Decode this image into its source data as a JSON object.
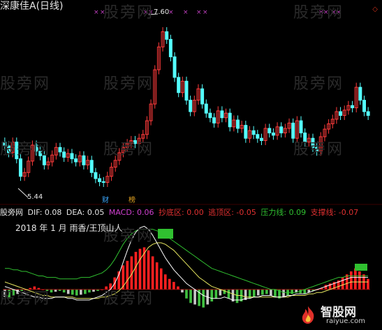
{
  "title": "深康佳A(日线)",
  "watermark": "股旁网",
  "price_high_label": "7.60",
  "price_low_label": "5.44",
  "event_markers": [
    {
      "label": "财",
      "color": "#3da9ff"
    },
    {
      "label": "榜",
      "color": "#e0a020"
    }
  ],
  "indicator": {
    "source": "股旁网",
    "items": [
      {
        "label": "DIF: 0.08",
        "color": "#e6e6e6"
      },
      {
        "label": "DEA: 0.05",
        "color": "#e6e6e6"
      },
      {
        "label": "MACD: 0.06",
        "color": "#d040d0"
      },
      {
        "label": "抄底区: 0.00",
        "color": "#e03030"
      },
      {
        "label": "逃顶区: -0.05",
        "color": "#e03030"
      },
      {
        "label": "压力线: 0.09",
        "color": "#30c030"
      },
      {
        "label": "支撑线: -0.07",
        "color": "#e03030"
      }
    ]
  },
  "period_note": "2018 年 1 月",
  "overlay_caption": "雨香/王顶山人",
  "logo": {
    "name": "智股网",
    "url": "raiyue.com"
  },
  "colors": {
    "up": "#ff3b3b",
    "down": "#54ffff",
    "macd_up": "#ff2020",
    "macd_down": "#40c040",
    "dif": "#ffffff",
    "dea": "#e8e860"
  },
  "chart_data": [
    {
      "type": "candlestick",
      "title": "深康佳A(日线)",
      "high": 7.6,
      "low": 5.44,
      "closes": [
        5.95,
        5.86,
        6.0,
        5.78,
        5.55,
        5.6,
        5.75,
        5.96,
        5.88,
        5.82,
        5.7,
        5.74,
        5.83,
        5.93,
        5.87,
        5.8,
        5.85,
        5.78,
        5.74,
        5.82,
        5.7,
        5.76,
        5.6,
        5.52,
        5.48,
        5.47,
        5.55,
        5.67,
        5.76,
        5.86,
        5.93,
        5.98,
        6.02,
        5.98,
        6.05,
        6.1,
        6.28,
        6.5,
        6.95,
        7.25,
        7.45,
        7.35,
        7.12,
        6.85,
        6.65,
        6.8,
        6.55,
        6.4,
        6.55,
        6.7,
        6.5,
        6.38,
        6.32,
        6.25,
        6.41,
        6.32,
        6.38,
        6.2,
        6.29,
        6.18,
        6.22,
        6.05,
        6.15,
        6.1,
        6.05,
        6.02,
        6.18,
        6.12,
        6.09,
        6.2,
        6.12,
        6.18,
        6.25,
        6.05,
        6.28,
        6.12,
        6.0,
        6.05,
        5.93,
        5.88,
        6.07,
        6.17,
        6.24,
        6.3,
        6.4,
        6.35,
        6.42,
        6.48,
        6.45,
        6.72,
        6.55,
        6.4,
        6.35
      ],
      "y_range": [
        5.3,
        7.72
      ],
      "legend": "none"
    },
    {
      "type": "bar",
      "title": "MACD",
      "series": [
        {
          "name": "MACD",
          "values": [
            -0.05,
            -0.06,
            -0.04,
            -0.03,
            -0.01,
            0.0,
            0.01,
            0.02,
            0.01,
            0.0,
            -0.01,
            -0.02,
            -0.015,
            -0.01,
            -0.02,
            -0.03,
            -0.035,
            -0.04,
            -0.035,
            -0.03,
            -0.02,
            -0.015,
            -0.01,
            0.0,
            0.02,
            0.04,
            0.08,
            0.12,
            0.16,
            0.19,
            0.22,
            0.25,
            0.27,
            0.28,
            0.26,
            0.22,
            0.18,
            0.14,
            0.1,
            0.07,
            0.05,
            0.02,
            -0.02,
            -0.06,
            -0.09,
            -0.1,
            -0.11,
            -0.12,
            -0.1,
            -0.08,
            -0.06,
            -0.04,
            -0.03,
            -0.06,
            -0.08,
            -0.09,
            -0.08,
            -0.07,
            -0.06,
            -0.05,
            -0.04,
            -0.035,
            -0.03,
            -0.04,
            -0.05,
            -0.06,
            -0.05,
            -0.04,
            -0.03,
            -0.02,
            -0.025,
            -0.03,
            -0.02,
            -0.01,
            0.0,
            0.01,
            0.03,
            0.04,
            0.05,
            0.06,
            0.08,
            0.1,
            0.12,
            0.14,
            0.12,
            0.1,
            0.07
          ]
        },
        {
          "name": "DIF",
          "values": [
            0.02,
            0.01,
            0.0,
            -0.01,
            -0.02,
            -0.03,
            -0.04,
            -0.05,
            -0.05,
            -0.06,
            -0.06,
            -0.06,
            -0.05,
            -0.05,
            -0.05,
            -0.06,
            -0.06,
            -0.07,
            -0.07,
            -0.07,
            -0.07,
            -0.06,
            -0.05,
            -0.04,
            -0.02,
            0.0,
            0.04,
            0.1,
            0.18,
            0.26,
            0.33,
            0.38,
            0.41,
            0.42,
            0.4,
            0.36,
            0.31,
            0.26,
            0.21,
            0.17,
            0.13,
            0.1,
            0.07,
            0.04,
            0.02,
            0.0,
            -0.02,
            -0.04,
            -0.05,
            -0.06,
            -0.06,
            -0.06,
            -0.05,
            -0.06,
            -0.07,
            -0.07,
            -0.07,
            -0.06,
            -0.06,
            -0.05,
            -0.05,
            -0.04,
            -0.04,
            -0.04,
            -0.05,
            -0.05,
            -0.05,
            -0.04,
            -0.04,
            -0.03,
            -0.03,
            -0.03,
            -0.02,
            -0.01,
            0.0,
            0.01,
            0.02,
            0.03,
            0.04,
            0.05,
            0.06,
            0.07,
            0.08,
            0.08,
            0.08,
            0.08,
            0.08
          ]
        },
        {
          "name": "DEA",
          "values": [
            0.05,
            0.04,
            0.03,
            0.02,
            0.01,
            0.0,
            -0.01,
            -0.02,
            -0.03,
            -0.04,
            -0.04,
            -0.05,
            -0.05,
            -0.05,
            -0.05,
            -0.05,
            -0.05,
            -0.06,
            -0.06,
            -0.06,
            -0.06,
            -0.06,
            -0.06,
            -0.05,
            -0.05,
            -0.04,
            -0.03,
            -0.01,
            0.02,
            0.06,
            0.1,
            0.15,
            0.2,
            0.24,
            0.28,
            0.3,
            0.31,
            0.31,
            0.3,
            0.28,
            0.26,
            0.23,
            0.2,
            0.17,
            0.14,
            0.11,
            0.08,
            0.06,
            0.04,
            0.02,
            0.01,
            0.0,
            -0.01,
            -0.02,
            -0.03,
            -0.04,
            -0.04,
            -0.05,
            -0.05,
            -0.05,
            -0.05,
            -0.05,
            -0.05,
            -0.05,
            -0.05,
            -0.05,
            -0.05,
            -0.05,
            -0.04,
            -0.04,
            -0.04,
            -0.04,
            -0.03,
            -0.03,
            -0.02,
            -0.02,
            -0.01,
            0.0,
            0.01,
            0.02,
            0.03,
            0.04,
            0.05,
            0.05,
            0.05,
            0.05,
            0.05
          ]
        },
        {
          "name": "压力线",
          "values": [
            0.14,
            0.14,
            0.13,
            0.13,
            0.12,
            0.12,
            0.11,
            0.1,
            0.09,
            0.09,
            0.08,
            0.08,
            0.08,
            0.07,
            0.07,
            0.07,
            0.07,
            0.07,
            0.08,
            0.08,
            0.08,
            0.09,
            0.1,
            0.11,
            0.13,
            0.16,
            0.2,
            0.25,
            0.3,
            0.34,
            0.37,
            0.39,
            0.4,
            0.4,
            0.4,
            0.4,
            0.39,
            0.38,
            0.36,
            0.34,
            0.32,
            0.3,
            0.28,
            0.26,
            0.24,
            0.22,
            0.2,
            0.18,
            0.16,
            0.14,
            0.13,
            0.12,
            0.11,
            0.1,
            0.09,
            0.08,
            0.07,
            0.06,
            0.05,
            0.04,
            0.03,
            0.02,
            0.01,
            0.0,
            0.0,
            -0.01,
            -0.02,
            -0.02,
            -0.02,
            -0.02,
            -0.01,
            0.0,
            0.01,
            0.02,
            0.03,
            0.04,
            0.05,
            0.06,
            0.07,
            0.08,
            0.08,
            0.09,
            0.09,
            0.09,
            0.09,
            0.09,
            0.09
          ]
        }
      ],
      "y_range": [
        -0.2,
        0.44
      ],
      "legend": "top"
    }
  ]
}
